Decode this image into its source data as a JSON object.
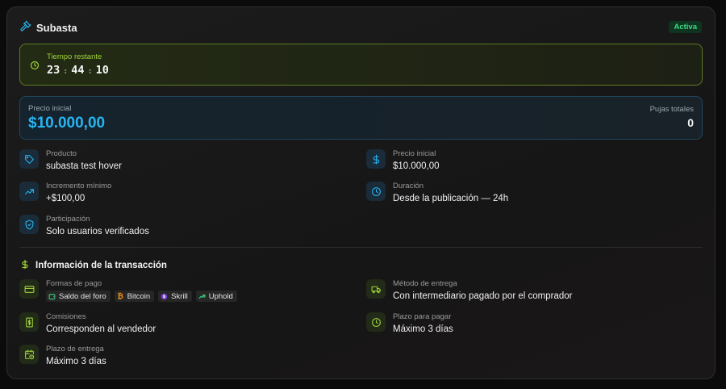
{
  "header": {
    "title": "Subasta",
    "status": "Activa"
  },
  "timer": {
    "label": "Tiempo restante",
    "hours": "23",
    "minutes": "44",
    "seconds": "10",
    "separator": ":"
  },
  "price": {
    "label": "Precio inicial",
    "value": "$10.000,00",
    "bids_label": "Pujas totales",
    "bids_value": "0"
  },
  "details": [
    {
      "label": "Producto",
      "value": "subasta test hover",
      "icon": "tag-icon"
    },
    {
      "label": "Precio inicial",
      "value": "$10.000,00",
      "icon": "dollar-icon"
    },
    {
      "label": "Incremento mínimo",
      "value": "+$100,00",
      "icon": "trending-up-icon"
    },
    {
      "label": "Duración",
      "value": "Desde la publicación — 24h",
      "icon": "clock-icon"
    },
    {
      "label": "Participación",
      "value": "Solo usuarios verificados",
      "icon": "shield-check-icon"
    }
  ],
  "transaction": {
    "title": "Información de la transacción",
    "payment": {
      "label": "Formas de pago",
      "methods": [
        "Saldo del foro",
        "Bitcoin",
        "Skrill",
        "Uphold"
      ]
    },
    "delivery_method": {
      "label": "Método de entrega",
      "value": "Con intermediario pagado por el comprador"
    },
    "fees": {
      "label": "Comisiones",
      "value": "Corresponden al vendedor"
    },
    "payment_term": {
      "label": "Plazo para pagar",
      "value": "Máximo 3 días"
    },
    "delivery_term": {
      "label": "Plazo de entrega",
      "value": "Máximo 3 días"
    }
  },
  "colors": {
    "blue_accent": "#27b5f2",
    "green_accent": "#9fd23a",
    "status_green": "#3ddc84"
  }
}
